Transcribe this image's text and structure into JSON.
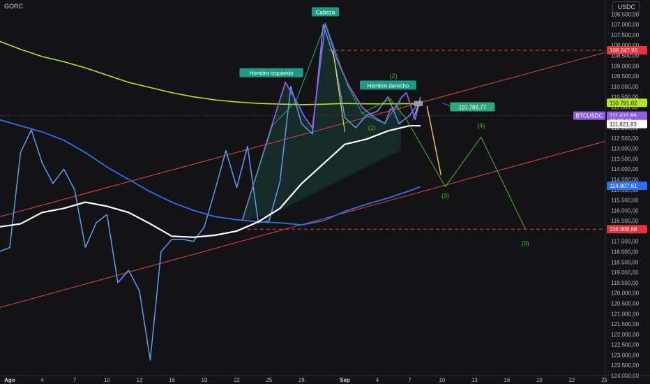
{
  "symbol": "GORC",
  "currency": "USDC",
  "colors": {
    "background": "#131316",
    "price_line": "#5b9cf6",
    "ema_blue": "#2f6fed",
    "ema_white": "#ffffff",
    "ema_green": "#b4e61e",
    "pattern_line": "#8f5ce6",
    "trend_line": "#e04848",
    "wave_line": "#49b52e",
    "fill": "#1e6b56",
    "neckline_drop": "#f2d13c"
  },
  "chart_data": {
    "type": "line",
    "y_axis": {
      "inverted": true,
      "range": [
        106150,
        124000
      ],
      "ticks": [
        106500,
        107000,
        107500,
        108000,
        108500,
        109000,
        109500,
        110000,
        110500,
        111000,
        111500,
        112000,
        112500,
        113000,
        113500,
        114000,
        114500,
        115000,
        115500,
        116000,
        116500,
        117000,
        117500,
        118000,
        118500,
        119000,
        119500,
        120000,
        120500,
        121000,
        121500,
        122000,
        122500,
        123000,
        123500,
        124000
      ],
      "tick_labels": [
        "106.500,00",
        "107.000,00",
        "107.500,00",
        "108.000,00",
        "108.500,00",
        "109.000,00",
        "109.500,00",
        "110.000,00",
        "110.500,00",
        "111.000,00",
        "111.500,00",
        "112.000,00",
        "112.500,00",
        "113.000,00",
        "113.500,00",
        "114.000,00",
        "114.500,00",
        "115.000,00",
        "115.500,00",
        "116.000,00",
        "116.500,00",
        "117.000,00",
        "117.500,00",
        "118.000,00",
        "118.500,00",
        "119.000,00",
        "119.500,00",
        "120.000,00",
        "120.500,00",
        "121.000,00",
        "121.500,00",
        "122.000,00",
        "122.500,00",
        "123.000,00",
        "123.500,00",
        "124.000,00"
      ]
    },
    "x_axis": {
      "unit": "day index (0 = 1 Ago)",
      "range": [
        -0.9,
        55.1
      ],
      "ticks": [
        0,
        3,
        6,
        9,
        12,
        15,
        18,
        21,
        24,
        27,
        31,
        34,
        37,
        40,
        43,
        46,
        49,
        52,
        55
      ],
      "tick_labels": [
        "Ago",
        "4",
        "7",
        "10",
        "13",
        "16",
        "19",
        "22",
        "25",
        "28",
        "Sep",
        "4",
        "7",
        "10",
        "13",
        "16",
        "19",
        "22",
        "25"
      ]
    },
    "series": [
      {
        "name": "BTCUSDC",
        "role": "price",
        "x": [
          -1,
          0,
          1,
          2,
          3,
          4,
          5,
          6,
          7,
          8,
          9,
          10,
          11,
          12,
          13,
          14,
          15,
          16,
          17,
          18,
          19,
          20,
          21,
          22,
          23,
          24,
          25,
          26,
          27,
          28,
          29,
          30,
          31,
          32,
          33,
          34,
          35,
          36,
          37,
          38
        ],
        "y": [
          118000,
          117800,
          113200,
          112100,
          113700,
          114700,
          114000,
          115000,
          117800,
          116600,
          116200,
          119500,
          118900,
          119900,
          123250,
          118000,
          117400,
          117400,
          117500,
          116800,
          115000,
          113100,
          114900,
          112900,
          116600,
          116500,
          114600,
          110000,
          111800,
          112300,
          107000,
          108600,
          111500,
          112000,
          111400,
          111200,
          110500,
          111800,
          111400,
          110650
        ]
      },
      {
        "name": "EMA blue",
        "role": "ema",
        "x": [
          -1,
          1,
          3,
          5,
          7,
          9,
          11,
          13,
          15,
          17,
          19,
          21,
          23,
          25,
          27,
          29,
          31,
          33,
          35,
          37,
          38
        ],
        "y": [
          111600,
          111900,
          112200,
          112600,
          113200,
          113900,
          114500,
          115100,
          115600,
          116000,
          116300,
          116450,
          116550,
          116600,
          116700,
          116500,
          116050,
          115700,
          115400,
          115050,
          114850
        ]
      },
      {
        "name": "EMA white",
        "role": "ema",
        "x": [
          -1,
          1,
          3,
          5,
          7,
          9,
          11,
          13,
          15,
          17,
          19,
          21,
          23,
          25,
          27,
          29,
          31,
          33,
          35,
          37,
          38
        ],
        "y": [
          116800,
          116650,
          116100,
          115900,
          115600,
          115800,
          116100,
          116650,
          117250,
          117300,
          117200,
          117000,
          116550,
          115900,
          114700,
          113750,
          112800,
          112550,
          112150,
          111900,
          111900
        ]
      },
      {
        "name": "EMA green",
        "role": "ema",
        "x": [
          -1,
          1,
          3,
          5,
          7,
          9,
          11,
          13,
          15,
          17,
          19,
          21,
          23,
          25,
          27,
          29,
          31,
          33,
          35,
          37,
          38
        ],
        "y": [
          107800,
          108200,
          108550,
          108800,
          109100,
          109450,
          109800,
          110050,
          110300,
          110500,
          110650,
          110750,
          110820,
          110850,
          110880,
          110860,
          110820,
          110840,
          110840,
          110830,
          110830
        ]
      },
      {
        "name": "Pattern",
        "role": "pattern",
        "x": [
          21.5,
          24.3,
          25.5,
          26.5,
          27.3,
          28.0,
          29.2,
          30.2,
          31.3,
          32.6,
          33.5,
          34.7,
          35.2,
          35.8,
          36.2,
          36.7,
          37.5,
          38.0
        ],
        "y": [
          116500,
          111800,
          109800,
          110700,
          111500,
          112000,
          106950,
          108600,
          109900,
          111000,
          111400,
          111800,
          111100,
          111000,
          110550,
          110300,
          111600,
          110500
        ]
      },
      {
        "name": "Wave projection",
        "role": "wave",
        "x": [
          36.6,
          37.4,
          38.0
        ],
        "y": [
          111500,
          110800,
          110500
        ]
      }
    ],
    "annotations": {
      "shoulder_left": "Hombro izquierdo",
      "head": "Cabeza",
      "shoulder_right": "Hombro derecho",
      "wave_labels": [
        "(1)",
        "(2)",
        "(3)",
        "(4)",
        "(5)"
      ],
      "target_label": "110.786,77"
    },
    "price_tags": [
      {
        "label": "108.247,95",
        "value": 108247.95,
        "color": "#e5343d",
        "text_color": "#ffffff"
      },
      {
        "label": "110.791,02",
        "value": 110791.02,
        "color": "#b4e61e",
        "text_color": "#131316"
      },
      {
        "label": "BTCUSDC",
        "value": 111410.86,
        "color": "#8f5ce6",
        "text_color": "#ffffff"
      },
      {
        "label": "111.410,86",
        "value": 111410.86,
        "color": "#8f5ce6",
        "text_color": "#ffffff"
      },
      {
        "label": "08:32:37",
        "value": 111660,
        "color": "#8f5ce6",
        "text_color": "#ffffff"
      },
      {
        "label": "111.821,83",
        "value": 111821.83,
        "color": "#ffffff",
        "text_color": "#131316"
      },
      {
        "label": "114.807,61",
        "value": 114807.61,
        "color": "#2f6fed",
        "text_color": "#ffffff"
      },
      {
        "label": "116.908,68",
        "value": 116908.68,
        "color": "#e5343d",
        "text_color": "#ffffff"
      }
    ],
    "grid": false
  }
}
